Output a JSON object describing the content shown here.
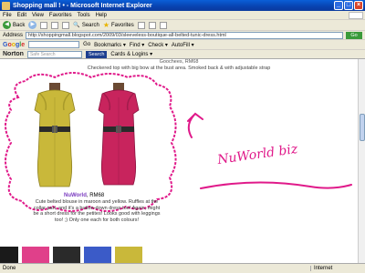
{
  "window": {
    "title": "Shopping mall ! • - Microsoft Internet Explorer",
    "controls": [
      "_",
      "□",
      "×"
    ]
  },
  "menu": [
    "File",
    "Edit",
    "View",
    "Favorites",
    "Tools",
    "Help"
  ],
  "toolbar": {
    "back": "Back",
    "search": "Search",
    "favorites": "Favorites"
  },
  "address": {
    "label": "Address",
    "url": "http://shoppingmall.blogspot.com/2009/03/sleeveless-boutique-all-belted-tunic-dress.html",
    "go": "Go"
  },
  "google": {
    "logo": [
      "G",
      "o",
      "o",
      "g",
      "l",
      "e"
    ],
    "items": [
      "Go",
      "Bookmarks ▾",
      "Find ▾",
      "Check ▾",
      "AutoFill ▾"
    ]
  },
  "norton": {
    "logo": "Norton",
    "search_placeholder": "Safe Search",
    "search_btn": "Search",
    "cards": "Cards & Logins ▾"
  },
  "page": {
    "caption_top_name": "Goochees, RM68",
    "caption_top": "Checkered top with big bow at the bust area. Smoked back & with adjustable strap",
    "store_brand": "NuWorld",
    "store_price": ", RM68",
    "description": "Cute belted blouse in maroon and yellow. Ruffles at the collar part, and it's a button-down dress too! Again, might be a short dress for the petites! Looks good with leggings too! ;) Only one each for both colours!",
    "handwritten": "NuWorld biz"
  },
  "status": {
    "done": "Done",
    "zone": "Internet"
  },
  "colors": {
    "cloud_border": "#e01a8a",
    "handwriting": "#e01a8a",
    "dress_yellow": "#c9b83a",
    "dress_pink": "#c8245d"
  }
}
